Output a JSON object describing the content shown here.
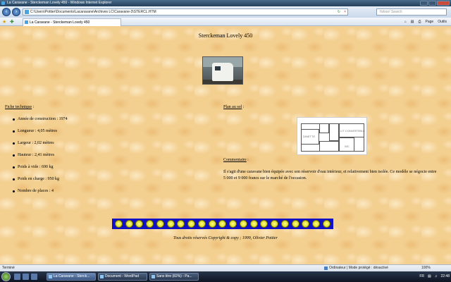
{
  "window": {
    "title": "La Caravane - Sterckeman Lovely 450 - Windows Internet Explorer"
  },
  "address": {
    "url": "C:\\Users\\Pottier\\Documents\\Lacaravane\\Archives LC\\Caravane-3\\STERCL.HTM",
    "search_placeholder": "Yahoo! Search"
  },
  "tab": {
    "label": "La Caravane - Sterckeman Lovely 450"
  },
  "commands": {
    "page": "Page",
    "tools": "Outils"
  },
  "page": {
    "title": "Sterckeman Lovely 450",
    "tech_heading": "Fiche technique",
    "tech_suffix": " :",
    "specs": [
      "Année de construction : 1974",
      "Longueur : 4,05 mètres",
      "Largeur : 2,02 mètres",
      "Hauteur : 2,41 mètres",
      "Poids à vide : 690 kg",
      "Poids en charge : 950 kg",
      "Nombre de places : 4"
    ],
    "plan_heading": "Plan au sol",
    "plan_suffix": " :",
    "plan_labels": {
      "dinette": "DINETTE",
      "bed": "LIT CONVERTIBLE",
      "wc": "WC"
    },
    "comment_heading": "Commentaire",
    "comment_suffix": " :",
    "comment_text": "Il s'agit d'une caravane bien équipée avec son réservoir d'eau intérieur, et relativement bien isolée. Ce modèle se négocie entre 5 000 et 9 000 francs sur le marché de l'occasion.",
    "nav_icon_count": 21,
    "copyright": "Tous droits réservés Copyright & copy ; 1999, Olivier Pottier"
  },
  "status": {
    "left": "Terminé",
    "zone": "Ordinateur | Mode protégé : désactivé",
    "zoom": "100%"
  },
  "taskbar": {
    "items": [
      {
        "label": "La Caravane - Sterck...",
        "active": true
      },
      {
        "label": "Document - WordPad",
        "active": false
      },
      {
        "label": "Sans titre (82%) - Pa...",
        "active": false
      }
    ],
    "lang": "FR",
    "time": "22:48"
  }
}
